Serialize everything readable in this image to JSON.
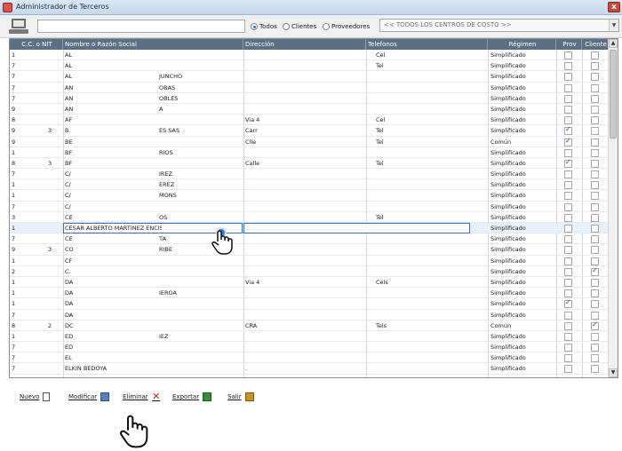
{
  "window": {
    "title": "Administrador de Terceros",
    "close_label": "x"
  },
  "toolbar": {
    "search_value": "",
    "radio_todos": "Todos",
    "radio_clientes": "Clientes",
    "radio_proveedores": "Proveedores",
    "selected_filter": "Todos",
    "cost_center_value": "<< TODOS LOS CENTROS DE COSTO >>"
  },
  "grid": {
    "headers": {
      "nit": "C.C. o NIT",
      "nombre": "Nombre o Razón Social",
      "direccion": "Dirección",
      "telefonos": "Telefonos",
      "regimen": "Régimen",
      "prov": "Prov",
      "cliente": "Cliente"
    },
    "rows": [
      {
        "nit": "1",
        "mark": "",
        "nombre_a": "AL",
        "nombre_b": "",
        "dir": "",
        "tel": "Cel",
        "regimen": "Simplificado",
        "prov": false,
        "cliente": false
      },
      {
        "nit": "7",
        "mark": "",
        "nombre_a": "AL",
        "nombre_b": "",
        "dir": "",
        "tel": "Tel",
        "regimen": "Simplificado",
        "prov": false,
        "cliente": false
      },
      {
        "nit": "7",
        "mark": "",
        "nombre_a": "AL",
        "nombre_b": "JUNCHO",
        "dir": "",
        "tel": "",
        "regimen": "Simplificado",
        "prov": false,
        "cliente": false
      },
      {
        "nit": "7",
        "mark": "",
        "nombre_a": "AN",
        "nombre_b": "OBAS",
        "dir": "",
        "tel": "",
        "regimen": "Simplificado",
        "prov": false,
        "cliente": false
      },
      {
        "nit": "7",
        "mark": "",
        "nombre_a": "AN",
        "nombre_b": "OBLES",
        "dir": "",
        "tel": "",
        "regimen": "Simplificado",
        "prov": false,
        "cliente": false
      },
      {
        "nit": "9",
        "mark": "",
        "nombre_a": "AN",
        "nombre_b": "A",
        "dir": "",
        "tel": "",
        "regimen": "Simplificado",
        "prov": false,
        "cliente": false
      },
      {
        "nit": "8",
        "mark": "",
        "nombre_a": "AF",
        "nombre_b": "",
        "dir": "Via 4",
        "tel": "Cel",
        "regimen": "Simplificado",
        "prov": false,
        "cliente": false
      },
      {
        "nit": "9",
        "mark": "3",
        "nombre_a": "B.",
        "nombre_b": "ES SAS",
        "dir": "Carr",
        "tel": "Tel",
        "regimen": "Simplificado",
        "prov": true,
        "cliente": false
      },
      {
        "nit": "9",
        "mark": "",
        "nombre_a": "BE",
        "nombre_b": "",
        "dir": "Clle",
        "tel": "Tel",
        "regimen": "Común",
        "prov": true,
        "cliente": false
      },
      {
        "nit": "1",
        "mark": "",
        "nombre_a": "BF",
        "nombre_b": "RIOS",
        "dir": "",
        "tel": "",
        "regimen": "Simplificado",
        "prov": false,
        "cliente": false
      },
      {
        "nit": "8",
        "mark": "3",
        "nombre_a": "BF",
        "nombre_b": "",
        "dir": "Calle",
        "tel": "Tel",
        "regimen": "Simplificado",
        "prov": true,
        "cliente": false
      },
      {
        "nit": "7",
        "mark": "",
        "nombre_a": "C/",
        "nombre_b": "IREZ",
        "dir": "",
        "tel": "",
        "regimen": "Simplificado",
        "prov": false,
        "cliente": false
      },
      {
        "nit": "1",
        "mark": "",
        "nombre_a": "C/",
        "nombre_b": "EREZ",
        "dir": "",
        "tel": "",
        "regimen": "Simplificado",
        "prov": false,
        "cliente": false
      },
      {
        "nit": "1",
        "mark": "",
        "nombre_a": "C/",
        "nombre_b": "MONS",
        "dir": "",
        "tel": "",
        "regimen": "Simplificado",
        "prov": false,
        "cliente": false
      },
      {
        "nit": "7",
        "mark": "",
        "nombre_a": "C/",
        "nombre_b": "",
        "dir": "",
        "tel": "",
        "regimen": "Simplificado",
        "prov": false,
        "cliente": false
      },
      {
        "nit": "3",
        "mark": "",
        "nombre_a": "CE",
        "nombre_b": "OS",
        "dir": "",
        "tel": "Tel",
        "regimen": "Simplificado",
        "prov": false,
        "cliente": false
      },
      {
        "nit": "1",
        "mark": "",
        "nombre_a": "CESAR ALBERTO MARTINEZ ENCISO",
        "nombre_b": "",
        "dir": "",
        "tel": "",
        "regimen": "Simplificado",
        "prov": false,
        "cliente": false,
        "selected": true
      },
      {
        "nit": "7",
        "mark": "",
        "nombre_a": "CE",
        "nombre_b": "TA",
        "dir": "",
        "tel": "",
        "regimen": "Simplificado",
        "prov": false,
        "cliente": false
      },
      {
        "nit": "9",
        "mark": "3",
        "nombre_a": "CO",
        "nombre_b": "RIBE",
        "dir": "",
        "tel": "",
        "regimen": "Simplificado",
        "prov": false,
        "cliente": false
      },
      {
        "nit": "1",
        "mark": "",
        "nombre_a": "CF",
        "nombre_b": "",
        "dir": "",
        "tel": "",
        "regimen": "Simplificado",
        "prov": false,
        "cliente": false
      },
      {
        "nit": "2",
        "mark": "",
        "nombre_a": "C.",
        "nombre_b": "",
        "dir": "",
        "tel": "",
        "regimen": "Simplificado",
        "prov": false,
        "cliente": true
      },
      {
        "nit": "1",
        "mark": "",
        "nombre_a": "DA",
        "nombre_b": "",
        "dir": "Via 4",
        "tel": "Cels",
        "regimen": "Simplificado",
        "prov": false,
        "cliente": false
      },
      {
        "nit": "1",
        "mark": "",
        "nombre_a": "DA",
        "nombre_b": "IEROA",
        "dir": "",
        "tel": "",
        "regimen": "Simplificado",
        "prov": false,
        "cliente": false
      },
      {
        "nit": "1",
        "mark": "",
        "nombre_a": "DA",
        "nombre_b": "",
        "dir": "",
        "tel": "",
        "regimen": "Simplificado",
        "prov": true,
        "cliente": false
      },
      {
        "nit": "7",
        "mark": "",
        "nombre_a": "DA",
        "nombre_b": "",
        "dir": "",
        "tel": "",
        "regimen": "Simplificado",
        "prov": false,
        "cliente": false
      },
      {
        "nit": "8",
        "mark": "2",
        "nombre_a": "DC",
        "nombre_b": "",
        "dir": "CRA",
        "tel": "Tels",
        "regimen": "Común",
        "prov": false,
        "cliente": true
      },
      {
        "nit": "1",
        "mark": "",
        "nombre_a": "ED",
        "nombre_b": "IEZ",
        "dir": "",
        "tel": "",
        "regimen": "Simplificado",
        "prov": false,
        "cliente": false
      },
      {
        "nit": "7",
        "mark": "",
        "nombre_a": "ED",
        "nombre_b": "",
        "dir": "",
        "tel": "",
        "regimen": "Simplificado",
        "prov": false,
        "cliente": false
      },
      {
        "nit": "7",
        "mark": "",
        "nombre_a": "EL",
        "nombre_b": "",
        "dir": "",
        "tel": "",
        "regimen": "Simplificado",
        "prov": false,
        "cliente": false
      },
      {
        "nit": "7",
        "mark": "",
        "nombre_a": "ELKIN BEDOYA",
        "nombre_b": "",
        "dir": ".",
        "tel": "",
        "regimen": "Simplificado",
        "prov": false,
        "cliente": false
      }
    ]
  },
  "footer": {
    "nuevo": "Nuevo",
    "modificar": "Modificar",
    "eliminar": "Eliminar",
    "exportar": "Exportar",
    "salir": "Salir"
  },
  "icons": {
    "nuevo": "new-document-icon",
    "modificar": "edit-icon",
    "eliminar": "delete-x-icon",
    "exportar": "excel-export-icon",
    "salir": "exit-icon",
    "app": "app-icon",
    "toolbar": "computer-icon",
    "cursor": "hand-pointer-icon"
  },
  "colors": {
    "header_bg": "#5d6f82",
    "selected_row": "#e6f1fb",
    "accent": "#2d7fd6",
    "delete": "#dd2222"
  }
}
